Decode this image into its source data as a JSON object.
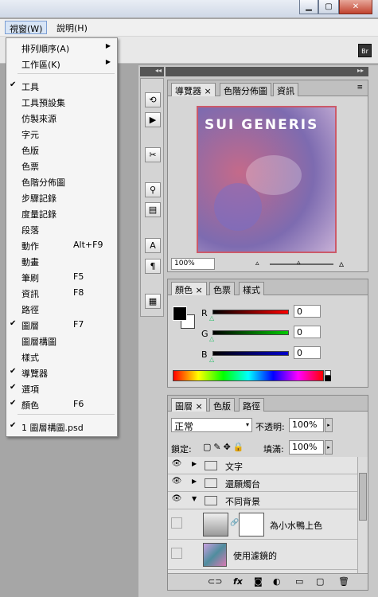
{
  "window": {
    "minimize_icon": "minimize-icon",
    "maximize_icon": "maximize-icon",
    "close_icon": "close-icon"
  },
  "menubar": {
    "view": "視窗(W)",
    "help": "說明(H)"
  },
  "optbar": {
    "bridge_label": "Br"
  },
  "menu": {
    "items": [
      {
        "label": "排列順序(A)",
        "submenu": true,
        "checked": false,
        "shortcut": ""
      },
      {
        "label": "工作區(K)",
        "submenu": true,
        "checked": false,
        "shortcut": ""
      },
      {
        "label": "工具",
        "checked": true,
        "shortcut": ""
      },
      {
        "label": "工具預設集",
        "checked": false,
        "shortcut": ""
      },
      {
        "label": "仿製來源",
        "checked": false,
        "shortcut": ""
      },
      {
        "label": "字元",
        "checked": false,
        "shortcut": ""
      },
      {
        "label": "色版",
        "checked": false,
        "shortcut": ""
      },
      {
        "label": "色票",
        "checked": false,
        "shortcut": ""
      },
      {
        "label": "色階分佈圖",
        "checked": false,
        "shortcut": ""
      },
      {
        "label": "步驟記錄",
        "checked": false,
        "shortcut": ""
      },
      {
        "label": "度量記錄",
        "checked": false,
        "shortcut": ""
      },
      {
        "label": "段落",
        "checked": false,
        "shortcut": ""
      },
      {
        "label": "動作",
        "checked": false,
        "shortcut": "Alt+F9"
      },
      {
        "label": "動畫",
        "checked": false,
        "shortcut": ""
      },
      {
        "label": "筆刷",
        "checked": false,
        "shortcut": "F5"
      },
      {
        "label": "資訊",
        "checked": false,
        "shortcut": "F8"
      },
      {
        "label": "路徑",
        "checked": false,
        "shortcut": ""
      },
      {
        "label": "圖層",
        "checked": true,
        "shortcut": "F7"
      },
      {
        "label": "圖層構圖",
        "checked": false,
        "shortcut": ""
      },
      {
        "label": "樣式",
        "checked": false,
        "shortcut": ""
      },
      {
        "label": "導覽器",
        "checked": true,
        "shortcut": ""
      },
      {
        "label": "選項",
        "checked": true,
        "shortcut": ""
      },
      {
        "label": "顏色",
        "checked": true,
        "shortcut": "F6"
      },
      {
        "label": "1 圖層構圖.psd",
        "checked": true,
        "shortcut": ""
      }
    ]
  },
  "navigator": {
    "tabs": [
      "導覽器",
      "色階分佈圖",
      "資訊"
    ],
    "preview_title": "SUI GENERIS",
    "zoom": "100%"
  },
  "color": {
    "tabs": [
      "顏色",
      "色票",
      "樣式"
    ],
    "r_label": "R",
    "g_label": "G",
    "b_label": "B",
    "r_value": "0",
    "g_value": "0",
    "b_value": "0"
  },
  "layers": {
    "tabs": [
      "圖層",
      "色版",
      "路徑"
    ],
    "blend_mode": "正常",
    "opacity_label": "不透明:",
    "opacity": "100%",
    "lock_label": "鎖定:",
    "fill_label": "填滿:",
    "fill": "100%",
    "rows": [
      "文字",
      "還願燭台",
      "不同背景",
      "為小水鴨上色",
      "使用濾鏡的"
    ]
  },
  "colors": {
    "accent": "#cc5a69",
    "menu_highlight": "#d8e5f6"
  }
}
